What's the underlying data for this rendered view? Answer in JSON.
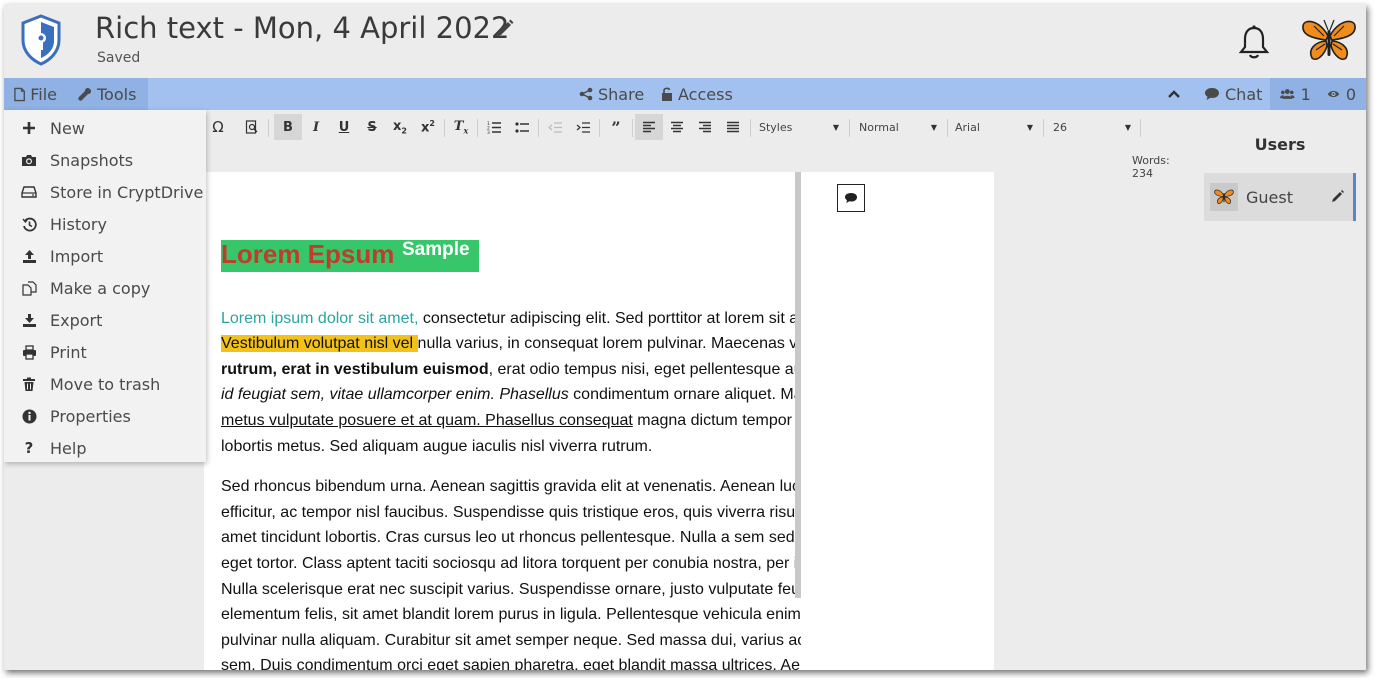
{
  "header": {
    "title": "Rich text - Mon, 4 April 2022",
    "status": "Saved"
  },
  "menubar": {
    "file": "File",
    "tools": "Tools",
    "share": "Share",
    "access": "Access",
    "chat": "Chat",
    "users_count": "1",
    "viewers_count": "0"
  },
  "file_menu": {
    "items": [
      {
        "label": "New",
        "icon": "plus-icon"
      },
      {
        "label": "Snapshots",
        "icon": "camera-icon"
      },
      {
        "label": "Store in CryptDrive",
        "icon": "drive-icon"
      },
      {
        "label": "History",
        "icon": "history-icon"
      },
      {
        "label": "Import",
        "icon": "upload-icon"
      },
      {
        "label": "Make a copy",
        "icon": "copy-icon"
      },
      {
        "label": "Export",
        "icon": "download-icon"
      },
      {
        "label": "Print",
        "icon": "print-icon"
      },
      {
        "label": "Move to trash",
        "icon": "trash-icon"
      },
      {
        "label": "Properties",
        "icon": "info-icon"
      },
      {
        "label": "Help",
        "icon": "question-icon"
      }
    ]
  },
  "toolbar": {
    "styles": "Styles",
    "format": "Normal",
    "font": "Arial",
    "size": "26",
    "word_count": "Words: 234"
  },
  "document": {
    "heading": "Lorem Epsum",
    "heading_sup": "Sample",
    "p1_teal": "Lorem ipsum dolor sit amet,",
    "p1_a": " consectetur adipiscing elit. Sed porttitor at lorem sit amet vulputate. ",
    "p1_highlight": "Vestibulum volutpat nisl vel ",
    "p1_b": "nulla varius, in consequat lorem pulvinar. Maecenas vitae feugiat libero. Fusce ",
    "p1_bold": "rutrum, erat in vestibulum euismod",
    "p1_c": ", erat odio tempus nisi, eget pellentesque augue turpis et est. Etiam ",
    "p1_italic": "id feugiat sem, vitae ullamcorper enim. Phasellus",
    "p1_d": " condimentum ornare aliquet. Maecenas et nunc vitae ",
    "p1_underline": "metus vulputate posuere et at quam. Phasellus consequat",
    "p1_e": " magna dictum tempor ullamcorper. Duis quis lobortis metus. Sed aliquam augue iaculis nisl viverra rutrum.",
    "p2": "Sed rhoncus bibendum urna. Aenean sagittis gravida elit at venenatis. Aenean luctus ante nec lectus efficitur, ac tempor nisl faucibus. Suspendisse quis tristique eros, quis viverra risus. Duis convallis tortor sit amet tincidunt lobortis. Cras cursus leo ut rhoncus pellentesque. Nulla a sem sed sem venenatis posuere a eget tortor. Class aptent taciti sociosqu ad litora torquent per conubia nostra, per inceptos himenaeos. Nulla scelerisque erat nec suscipit varius. Suspendisse ornare, justo vulputate feugiat imperdiet, dolor dolor elementum felis, sit amet blandit lorem purus in ligula. Pellentesque vehicula enim et diam ultrices, sed pulvinar nulla aliquam. Curabitur sit amet semper neque. Sed massa dui, varius ac libero a, cursus posuere sem. Duis condimentum orci eget sapien pharetra, eget blandit massa ultrices. Aenean tincidunt,"
  },
  "users_panel": {
    "title": "Users",
    "user_name": "Guest"
  },
  "colors": {
    "bluebar": "#a2c1ee",
    "heading_bg": "#37c76a",
    "heading_text": "#bf3d2a",
    "highlight": "#f2c21a",
    "teal_text": "#2aa5a0"
  }
}
